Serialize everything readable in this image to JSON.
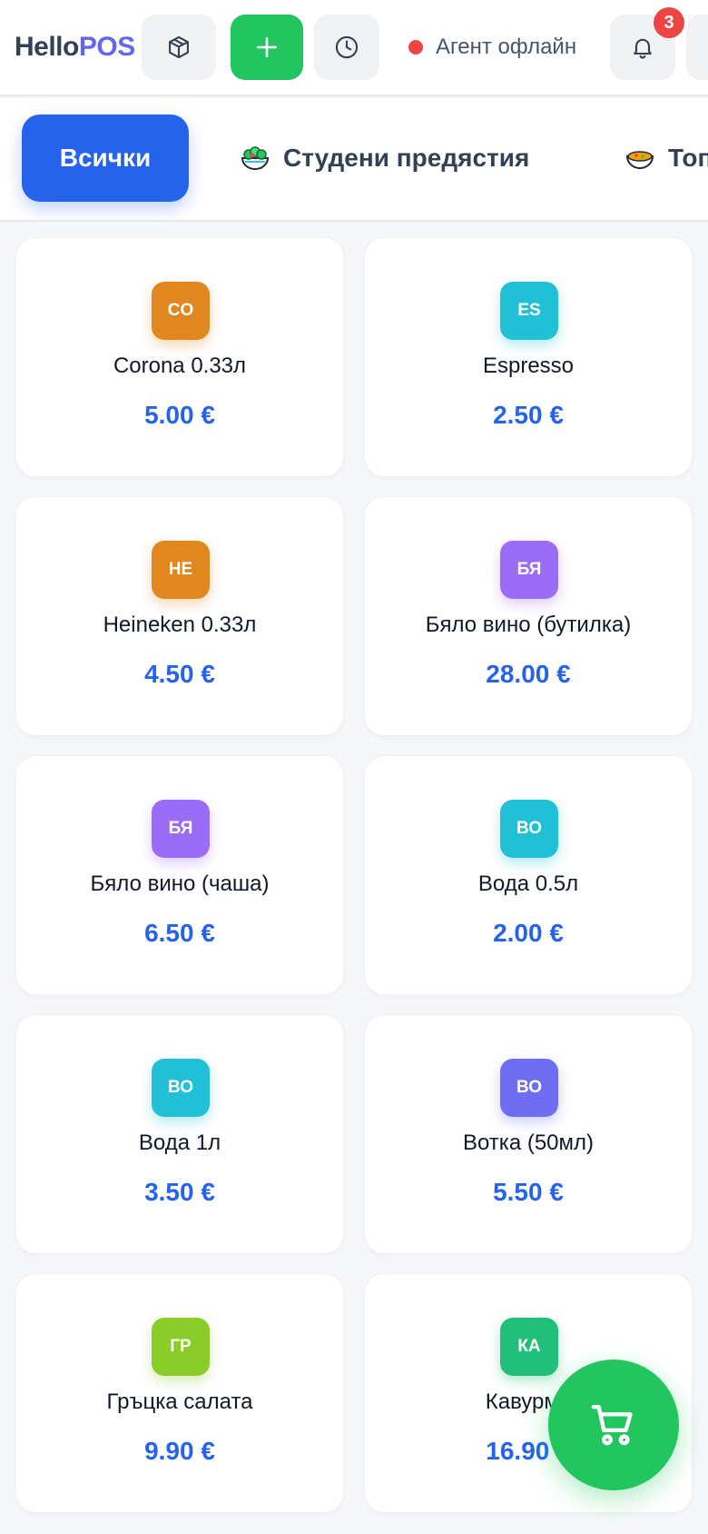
{
  "header": {
    "logo_part1": "Hello",
    "logo_part2": "POS",
    "status_text": "Агент офлайн",
    "notification_count": "3",
    "colors": {
      "accent": "#2563eb",
      "brand": "#6366f1",
      "add": "#22c55e",
      "offline": "#ef4444"
    }
  },
  "categories": {
    "active": "Всички",
    "items": [
      {
        "label": "Студени предястия",
        "icon": "salad-icon"
      },
      {
        "label": "Топ",
        "icon": "soup-icon"
      }
    ]
  },
  "products": [
    {
      "initials": "CO",
      "name": "Corona 0.33л",
      "price": "5.00 €",
      "color": "#e0881f"
    },
    {
      "initials": "ES",
      "name": "Espresso",
      "price": "2.50 €",
      "color": "#22c0d6"
    },
    {
      "initials": "HE",
      "name": "Heineken 0.33л",
      "price": "4.50 €",
      "color": "#e0881f"
    },
    {
      "initials": "БЯ",
      "name": "Бяло вино (бутилка)",
      "price": "28.00 €",
      "color": "#9b6cf5"
    },
    {
      "initials": "БЯ",
      "name": "Бяло вино (чаша)",
      "price": "6.50 €",
      "color": "#9b6cf5"
    },
    {
      "initials": "ВО",
      "name": "Вода 0.5л",
      "price": "2.00 €",
      "color": "#22c0d6"
    },
    {
      "initials": "ВО",
      "name": "Вода 1л",
      "price": "3.50 €",
      "color": "#22c0d6"
    },
    {
      "initials": "ВО",
      "name": "Вотка (50мл)",
      "price": "5.50 €",
      "color": "#6f6ef2"
    },
    {
      "initials": "ГР",
      "name": "Гръцка салата",
      "price": "9.90 €",
      "color": "#8ccc2a"
    },
    {
      "initials": "КА",
      "name": "Кавурма",
      "price": "16.90 €",
      "color": "#22bf7a"
    }
  ]
}
